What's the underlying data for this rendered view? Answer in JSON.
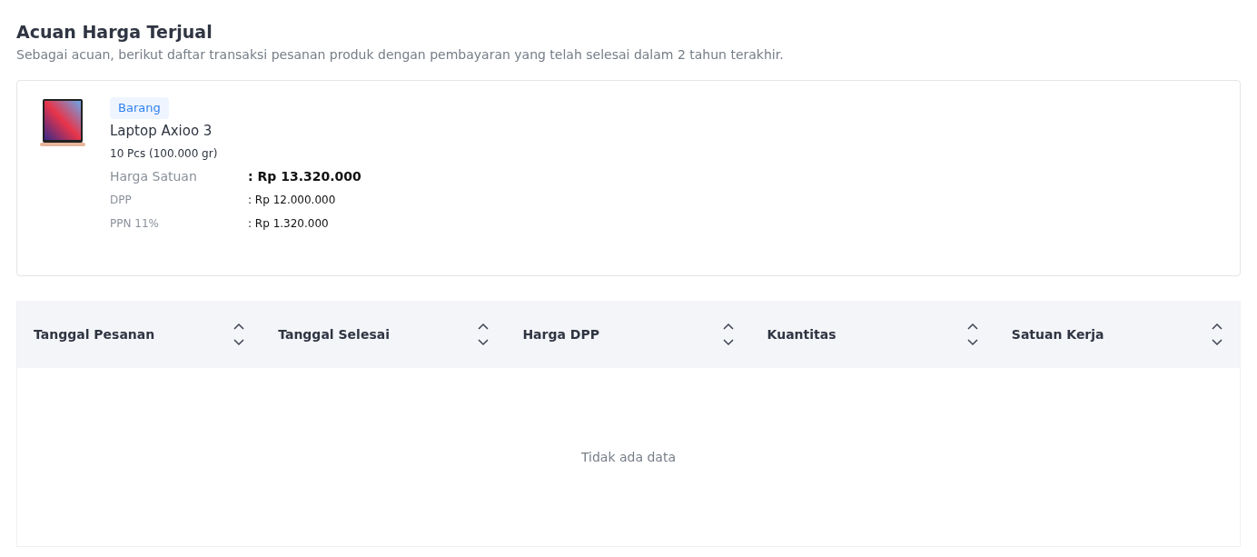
{
  "header": {
    "title": "Acuan Harga Terjual",
    "subtitle": "Sebagai acuan, berikut daftar transaksi pesanan produk dengan pembayaran yang telah selesai dalam 2 tahun terakhir."
  },
  "product": {
    "tag": "Barang",
    "name": "Laptop Axioo 3",
    "quantity": "10 Pcs (100.000 gr)",
    "prices": [
      {
        "kind": "main",
        "label": "Harga Satuan",
        "value": ": Rp 13.320.000"
      },
      {
        "kind": "sub",
        "label": "DPP",
        "value": ": Rp 12.000.000"
      },
      {
        "kind": "sub",
        "label": "PPN 11%",
        "value": ": Rp 1.320.000"
      }
    ]
  },
  "table": {
    "columns": [
      "Tanggal Pesanan",
      "Tanggal Selesai",
      "Harga DPP",
      "Kuantitas",
      "Satuan Kerja"
    ],
    "empty_text": "Tidak ada data"
  }
}
